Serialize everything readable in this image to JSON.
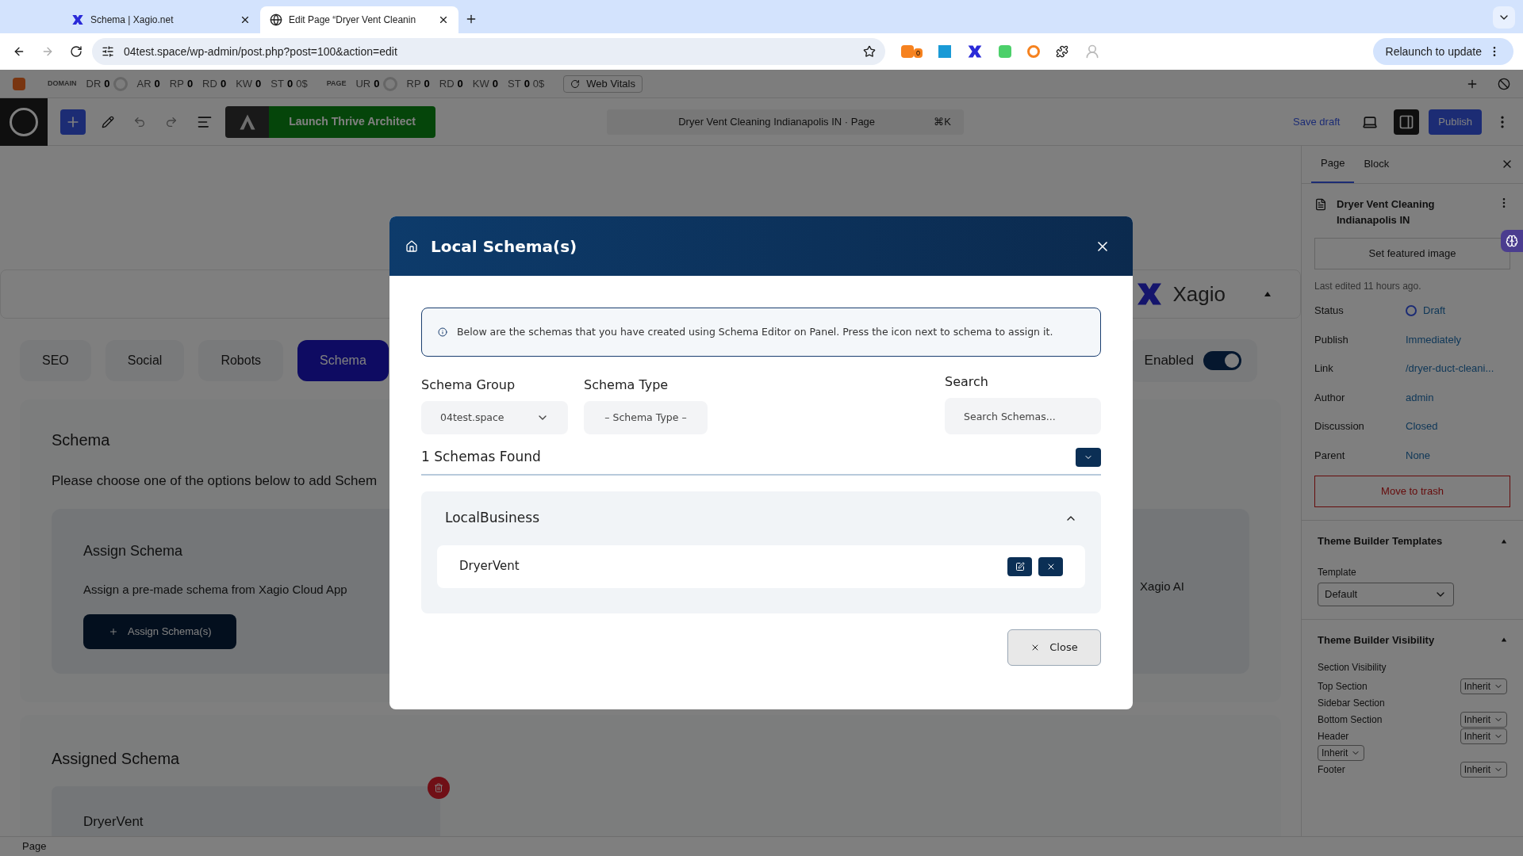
{
  "browser": {
    "tabs": [
      {
        "title": "Schema | Xagio.net",
        "selected": false
      },
      {
        "title": "Edit Page “Dryer Vent Cleanin",
        "selected": true
      }
    ],
    "address": "04test.space/wp-admin/post.php?post=100&action=edit",
    "extension_badge": "0",
    "relaunch_button": "Relaunch to update"
  },
  "seo_bar": {
    "domain_label": "DOMAIN",
    "domain_metrics": [
      {
        "label": "DR",
        "value": "0",
        "ring": true
      },
      {
        "label": "AR",
        "value": "0",
        "ring": false
      },
      {
        "label": "RP",
        "value": "0",
        "ring": false
      },
      {
        "label": "RD",
        "value": "0",
        "ring": false
      },
      {
        "label": "KW",
        "value": "0",
        "ring": false
      },
      {
        "label": "ST",
        "value": "0",
        "ring": false,
        "extra": "0$"
      }
    ],
    "page_label": "PAGE",
    "page_metrics": [
      {
        "label": "UR",
        "value": "0",
        "ring": true
      },
      {
        "label": "RP",
        "value": "0",
        "ring": false
      },
      {
        "label": "RD",
        "value": "0",
        "ring": false
      },
      {
        "label": "KW",
        "value": "0",
        "ring": false
      },
      {
        "label": "ST",
        "value": "0",
        "ring": false,
        "extra": "0$"
      }
    ],
    "web_vitals": "Web Vitals"
  },
  "editor_toolbar": {
    "launch_button": "Launch Thrive Architect",
    "document_title": "Dryer Vent Cleaning Indianapolis IN · Page",
    "shortcut": "⌘K",
    "save_draft": "Save draft",
    "publish": "Publish"
  },
  "plugin": {
    "brand": "Xagio",
    "tabs": [
      {
        "label": "SEO",
        "selected": false
      },
      {
        "label": "Social",
        "selected": false
      },
      {
        "label": "Robots",
        "selected": false
      },
      {
        "label": "Schema",
        "selected": true
      }
    ],
    "enabled_label": "Enabled",
    "enabled_on": true,
    "schema_card": {
      "title": "Schema",
      "text": "Please choose one of the options below to add Schem",
      "assign": {
        "title": "Assign Schema",
        "text": "Assign a pre-made schema from Xagio Cloud App",
        "button": "Assign Schema(s)"
      },
      "ai_text": "Xagio AI"
    },
    "assigned": {
      "title": "Assigned Schema",
      "items": [
        "DryerVent"
      ]
    }
  },
  "sidebar": {
    "tabs": [
      {
        "label": "Page",
        "selected": true
      },
      {
        "label": "Block",
        "selected": false
      }
    ],
    "post_title": "Dryer Vent Cleaning Indianapolis IN",
    "featured_button": "Set featured image",
    "last_edited": "Last edited 11 hours ago.",
    "rows": [
      {
        "label": "Status",
        "value": "Draft"
      },
      {
        "label": "Publish",
        "value": "Immediately"
      },
      {
        "label": "Link",
        "value": "/dryer-duct-cleani..."
      },
      {
        "label": "Author",
        "value": "admin"
      },
      {
        "label": "Discussion",
        "value": "Closed"
      },
      {
        "label": "Parent",
        "value": "None"
      }
    ],
    "trash_button": "Move to trash",
    "templates": {
      "title": "Theme Builder Templates",
      "label": "Template",
      "select": "Default"
    },
    "visibility": {
      "title": "Theme Builder Visibility",
      "subtitle": "Section Visibility",
      "rows": [
        {
          "label": "Top Section",
          "select": "Inherit"
        },
        {
          "label": "Sidebar Section"
        },
        {
          "label": "Bottom Section",
          "select": "Inherit"
        },
        {
          "label": "Header",
          "select": "Inherit"
        },
        {
          "select": "Inherit"
        },
        {
          "label": "Footer",
          "select": "Inherit"
        }
      ]
    }
  },
  "status_bar": "Page",
  "modal": {
    "title": "Local Schema(s)",
    "info": "Below are the schemas that you have created using Schema Editor on Panel. Press the icon next to schema to assign it.",
    "group_label": "Schema Group",
    "group_value": "04test.space",
    "type_label": "Schema Type",
    "type_value": "– Schema Type –",
    "search_label": "Search",
    "search_placeholder": "Search Schemas...",
    "found": "1 Schemas Found",
    "groups": [
      {
        "name": "LocalBusiness",
        "expanded": true,
        "items": [
          "DryerVent"
        ]
      }
    ],
    "close_button": "Close"
  }
}
